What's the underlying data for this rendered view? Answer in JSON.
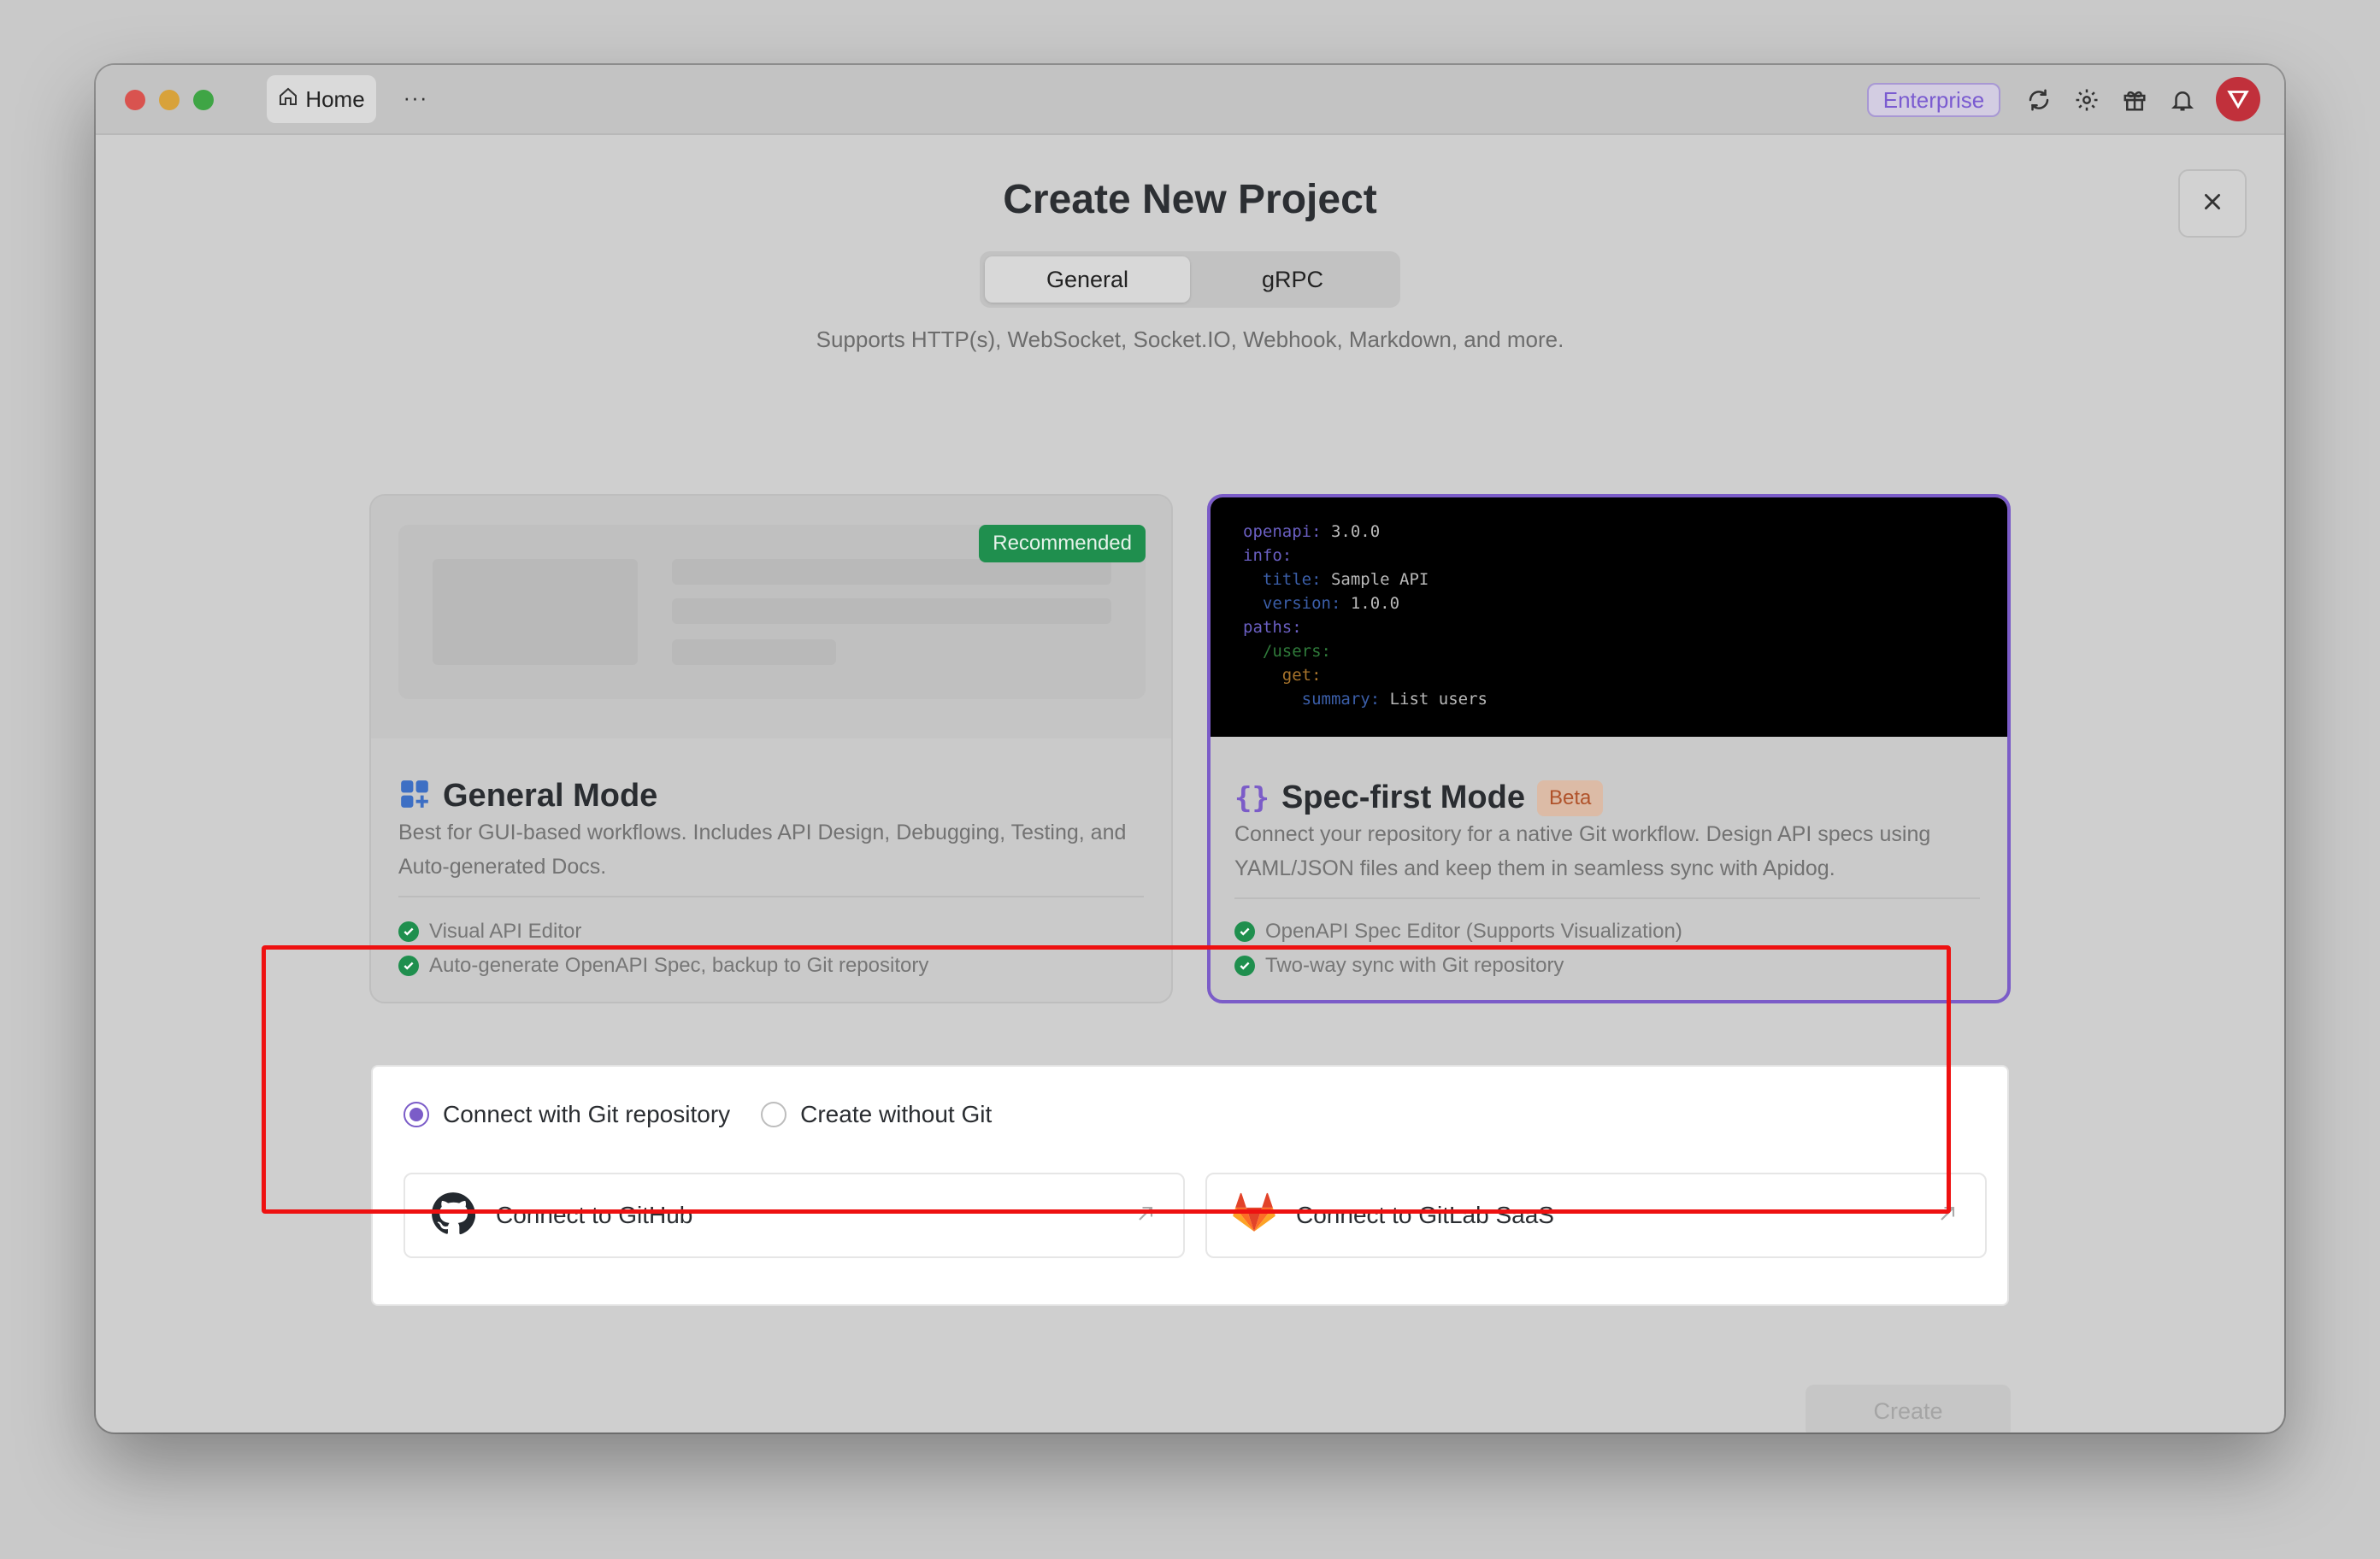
{
  "titlebar": {
    "home_label": "Home",
    "more_label": "···",
    "enterprise_label": "Enterprise"
  },
  "page": {
    "title": "Create New Project",
    "tabs": [
      "General",
      "gRPC"
    ],
    "active_tab": "General",
    "subtitle": "Supports HTTP(s), WebSocket, Socket.IO, Webhook, Markdown, and more."
  },
  "cards": {
    "general": {
      "badge": "Recommended",
      "title": "General Mode",
      "description": "Best for GUI-based workflows. Includes API Design, Debugging, Testing, and Auto-generated Docs.",
      "features": [
        "Visual API Editor",
        "Auto-generate OpenAPI Spec, backup to Git repository"
      ]
    },
    "spec": {
      "code": [
        {
          "key": "openapi:",
          "value": " 3.0.0",
          "indent": 0,
          "cls": "k1"
        },
        {
          "key": "info:",
          "value": "",
          "indent": 0,
          "cls": "k1"
        },
        {
          "key": "title:",
          "value": " Sample API",
          "indent": 1,
          "cls": "k2"
        },
        {
          "key": "version:",
          "value": " 1.0.0",
          "indent": 1,
          "cls": "k2"
        },
        {
          "key": "paths:",
          "value": "",
          "indent": 0,
          "cls": "k1"
        },
        {
          "key": "/users:",
          "value": "",
          "indent": 1,
          "cls": "k3"
        },
        {
          "key": "get:",
          "value": "",
          "indent": 2,
          "cls": "k4"
        },
        {
          "key": "summary:",
          "value": " List users",
          "indent": 3,
          "cls": "k2"
        }
      ],
      "title": "Spec-first Mode",
      "badge": "Beta",
      "description": "Connect your repository for a native Git workflow. Design API specs using YAML/JSON files and keep them in seamless sync with Apidog.",
      "features": [
        "OpenAPI Spec Editor (Supports Visualization)",
        "Two-way sync with Git repository"
      ]
    }
  },
  "git": {
    "options": [
      "Connect with Git repository",
      "Create without Git"
    ],
    "selected": "Connect with Git repository",
    "github_label": "Connect to GitHub",
    "gitlab_label": "Connect to GitLab SaaS"
  },
  "footer": {
    "create_label": "Create"
  },
  "colors": {
    "accent": "#7b5cc8",
    "success": "#1f8f4e",
    "highlight": "#ee1111"
  }
}
